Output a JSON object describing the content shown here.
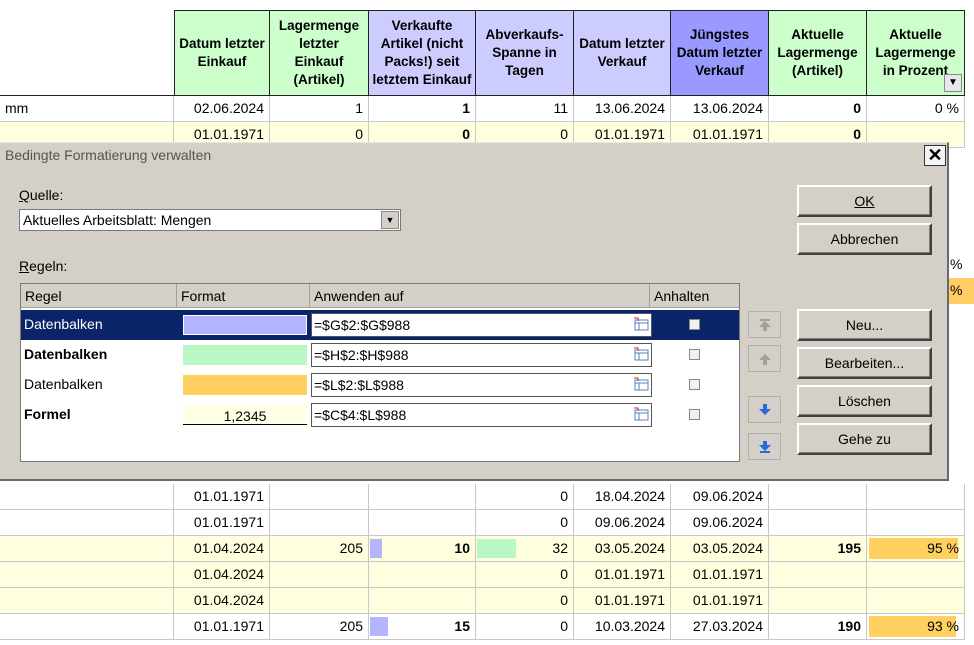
{
  "sheet": {
    "headers": [
      "Datum letzter Einkauf",
      "Lagermenge letzter Einkauf (Artikel)",
      "Verkaufte Artikel (nicht Packs!) seit letztem Einkauf",
      "Abverkaufs-Spanne in Tagen",
      "Datum letzter Verkauf",
      "Jüngstes Datum letzter Verkauf",
      "Aktuelle Lagermenge (Artikel)",
      "Aktuelle Lagermenge in Prozent"
    ],
    "header_colors": [
      "#ccffcc",
      "#ccffcc",
      "#ccccff",
      "#ccccff",
      "#ccccff",
      "#9999ff",
      "#ccffcc",
      "#ccffcc"
    ],
    "filter_arrow": "▼",
    "top_rows": [
      {
        "a": "mm",
        "c": "02.06.2024",
        "d": "1",
        "e": "1",
        "g": "11",
        "h": "13.06.2024",
        "i": "13.06.2024",
        "j": "0",
        "k": "0 %",
        "bg": "#ffffff",
        "bar_h": 0.13,
        "bar_g": 0
      },
      {
        "a": "",
        "c": "01.01.1971",
        "d": "0",
        "e": "0",
        "g": "0",
        "h": "01.01.1971",
        "i": "01.01.1971",
        "j": "0",
        "k": "",
        "bg": "#ffffe0",
        "bar_h": 0,
        "bar_g": 0
      }
    ],
    "bottom_rows": [
      {
        "c": "01.01.1971",
        "d": "",
        "e": "",
        "g": "0",
        "h": "18.04.2024",
        "i": "09.06.2024",
        "j": "",
        "k": "",
        "bg": "#ffffff",
        "bar_e": 0,
        "bar_g": 0,
        "bar_k": 0
      },
      {
        "c": "01.01.1971",
        "d": "",
        "e": "",
        "g": "0",
        "h": "09.06.2024",
        "i": "09.06.2024",
        "j": "",
        "k": "",
        "bg": "#ffffff",
        "bar_e": 0,
        "bar_g": 0,
        "bar_k": 0
      },
      {
        "c": "01.04.2024",
        "d": "205",
        "e": "10",
        "g": "32",
        "h": "03.05.2024",
        "i": "03.05.2024",
        "j": "195",
        "k": "95 %",
        "bg": "#ffffe0",
        "bar_e": 0.12,
        "bar_g": 0.42,
        "bar_k": 0.95
      },
      {
        "c": "01.04.2024",
        "d": "",
        "e": "",
        "g": "0",
        "h": "01.01.1971",
        "i": "01.01.1971",
        "j": "",
        "k": "",
        "bg": "#ffffe0",
        "bar_e": 0,
        "bar_g": 0,
        "bar_k": 0
      },
      {
        "c": "01.04.2024",
        "d": "",
        "e": "",
        "g": "0",
        "h": "01.01.1971",
        "i": "01.01.1971",
        "j": "",
        "k": "",
        "bg": "#ffffe0",
        "bar_e": 0,
        "bar_g": 0,
        "bar_k": 0
      },
      {
        "c": "01.01.1971",
        "d": "205",
        "e": "15",
        "g": "0",
        "h": "10.03.2024",
        "i": "27.03.2024",
        "j": "190",
        "k": "93 %",
        "bg": "#ffffff",
        "bar_e": 0.17,
        "bar_g": 0,
        "bar_k": 0.93
      }
    ],
    "right_edge_fragments": [
      "%",
      "%"
    ]
  },
  "dialog": {
    "title": "Bedingte Formatierung verwalten",
    "source_label_u": "Q",
    "source_label_rest": "uelle:",
    "source_value": "Aktuelles Arbeitsblatt: Mengen",
    "rules_label_u": "R",
    "rules_label_rest": "egeln:",
    "columns": [
      "Regel",
      "Format",
      "Anwenden auf",
      "Anhalten"
    ],
    "rules": [
      {
        "name": "Datenbalken",
        "bold": false,
        "format_color": "#b4b4ff",
        "format_text": "",
        "range": "=$G$2:$G$988",
        "selected": true
      },
      {
        "name": "Datenbalken",
        "bold": true,
        "format_color": "#b9f7c4",
        "format_text": "",
        "range": "=$H$2:$H$988",
        "selected": false
      },
      {
        "name": "Datenbalken",
        "bold": false,
        "format_color": "#ffd060",
        "format_text": "",
        "range": "=$L$2:$L$988",
        "selected": false
      },
      {
        "name": "Formel",
        "bold": true,
        "format_color": "#ffffe6",
        "format_text": "1,2345",
        "range": "=$C$4:$L$988",
        "selected": false
      }
    ],
    "buttons": {
      "ok": "OK",
      "cancel": "Abbrechen",
      "new": "Neu...",
      "edit": "Bearbeiten...",
      "delete": "Löschen",
      "goto": "Gehe zu"
    },
    "accent": "#0a246a",
    "move_icons": [
      "move-top-icon",
      "move-up-icon",
      "move-down-icon",
      "move-bottom-icon"
    ]
  }
}
